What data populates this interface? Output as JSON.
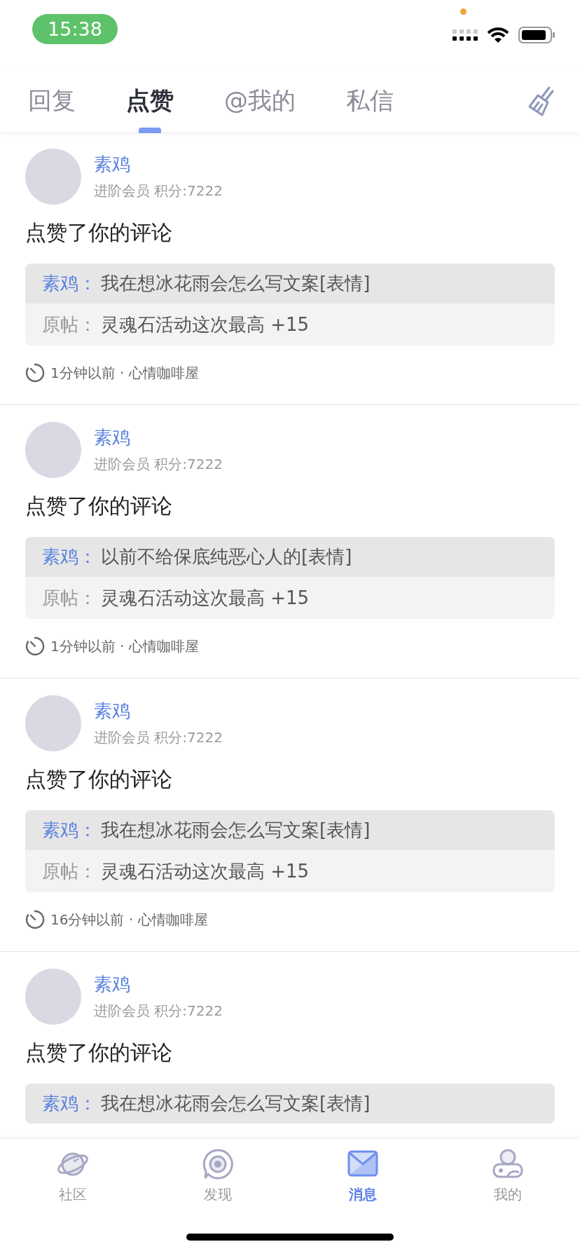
{
  "status_bar": {
    "time": "15:38"
  },
  "tabs": [
    {
      "label": "回复",
      "selected": false
    },
    {
      "label": "点赞",
      "selected": true
    },
    {
      "label": "@我的",
      "selected": false
    },
    {
      "label": "私信",
      "selected": false
    }
  ],
  "notifications": [
    {
      "user": "素鸡",
      "member_info": "进阶会员 积分:7222",
      "action": "点赞了你的评论",
      "comment_author": "素鸡：",
      "comment": "我在想冰花雨会怎么写文案[表情]",
      "origin_label": "原帖：",
      "origin": "灵魂石活动这次最高 +15",
      "meta": "1分钟以前 · 心情咖啡屋"
    },
    {
      "user": "素鸡",
      "member_info": "进阶会员 积分:7222",
      "action": "点赞了你的评论",
      "comment_author": "素鸡：",
      "comment": "以前不给保底纯恶心人的[表情]",
      "origin_label": "原帖：",
      "origin": "灵魂石活动这次最高 +15",
      "meta": "1分钟以前 · 心情咖啡屋"
    },
    {
      "user": "素鸡",
      "member_info": "进阶会员 积分:7222",
      "action": "点赞了你的评论",
      "comment_author": "素鸡：",
      "comment": "我在想冰花雨会怎么写文案[表情]",
      "origin_label": "原帖：",
      "origin": "灵魂石活动这次最高 +15",
      "meta": "16分钟以前 · 心情咖啡屋"
    },
    {
      "user": "素鸡",
      "member_info": "进阶会员 积分:7222",
      "action": "点赞了你的评论",
      "comment_author": "素鸡：",
      "comment": "我在想冰花雨会怎么写文案[表情]"
    }
  ],
  "bottom_nav": [
    {
      "label": "社区",
      "selected": false
    },
    {
      "label": "发现",
      "selected": false
    },
    {
      "label": "消息",
      "selected": true
    },
    {
      "label": "我的",
      "selected": false
    }
  ]
}
